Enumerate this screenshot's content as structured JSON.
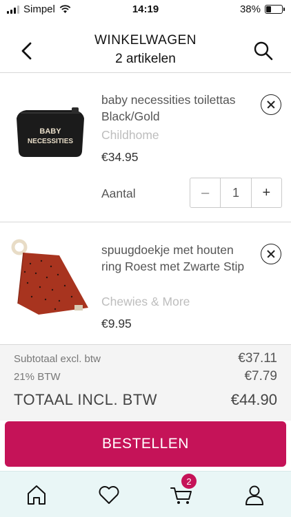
{
  "status_bar": {
    "carrier": "Simpel",
    "time": "14:19",
    "battery": "38%",
    "battery_level": 0.38
  },
  "header": {
    "title": "WINKELWAGEN",
    "subtitle": "2 artikelen"
  },
  "cart": {
    "items": [
      {
        "name": "baby necessities toilettas Black/Gold",
        "brand": "Childhome",
        "price": "€34.95",
        "quantity_label": "Aantal",
        "quantity": "1",
        "thumb_text_1": "BABY",
        "thumb_text_2": "NECESSITIES"
      },
      {
        "name": "spuugdoekje met houten ring Roest met Zwarte Stip",
        "brand": "Chewies & More",
        "price": "€9.95"
      }
    ]
  },
  "totals": {
    "subtotal_label": "Subtotaal excl. btw",
    "subtotal_value": "€37.11",
    "btw_label": "21% BTW",
    "btw_value": "€7.79",
    "total_label": "TOTAAL INCL. BTW",
    "total_value": "€44.90"
  },
  "checkout": {
    "button_label": "BESTELLEN"
  },
  "tabbar": {
    "cart_badge": "2"
  },
  "colors": {
    "accent": "#c51358",
    "tabbar_bg": "#e9f6f6",
    "totals_bg": "#f4f4f4"
  }
}
